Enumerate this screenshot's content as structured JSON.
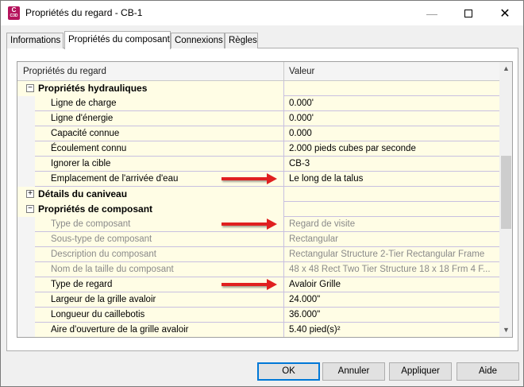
{
  "window": {
    "title": "Propriétés du regard - CB-1",
    "app_icon_letter": "C",
    "app_icon_sub": "C3D",
    "minimize_glyph": "—",
    "close_glyph": "✕"
  },
  "tabs": [
    {
      "label": "Informations",
      "active": false
    },
    {
      "label": "Propriétés du composant",
      "active": true
    },
    {
      "label": "Connexions",
      "active": false
    },
    {
      "label": "Règles",
      "active": false
    }
  ],
  "grid": {
    "headers": {
      "name": "Propriétés du regard",
      "value": "Valeur"
    },
    "rows": [
      {
        "kind": "category",
        "name": "Propriétés hydrauliques",
        "toggle": "−"
      },
      {
        "kind": "item",
        "name": "Ligne de charge",
        "value": "0.000'"
      },
      {
        "kind": "item",
        "name": "Ligne d'énergie",
        "value": "0.000'"
      },
      {
        "kind": "item",
        "name": "Capacité connue",
        "value": "0.000"
      },
      {
        "kind": "item",
        "name": "Écoulement connu",
        "value": "2.000 pieds cubes par seconde"
      },
      {
        "kind": "item",
        "name": "Ignorer la cible",
        "value": "CB-3"
      },
      {
        "kind": "item",
        "name": "Emplacement de l'arrivée d'eau",
        "value": "Le long de la talus"
      },
      {
        "kind": "category",
        "name": "Détails du caniveau",
        "toggle": "+"
      },
      {
        "kind": "category",
        "name": "Propriétés de composant",
        "toggle": "−"
      },
      {
        "kind": "dim",
        "name": "Type de composant",
        "value": "Regard de visite"
      },
      {
        "kind": "dim",
        "name": "Sous-type de composant",
        "value": "Rectangular"
      },
      {
        "kind": "dim",
        "name": "Description du composant",
        "value": "Rectangular Structure 2-Tier Rectangular Frame"
      },
      {
        "kind": "dim",
        "name": "Nom de la taille du composant",
        "value": "48 x 48 Rect Two Tier Structure 18 x 18 Frm 4 F..."
      },
      {
        "kind": "item",
        "name": "Type de regard",
        "value": "Avaloir Grille"
      },
      {
        "kind": "item",
        "name": "Largeur de la grille avaloir",
        "value": "24.000\""
      },
      {
        "kind": "item",
        "name": "Longueur du caillebotis",
        "value": "36.000\""
      },
      {
        "kind": "item",
        "name": "Aire d'ouverture de la grille avaloir",
        "value": "5.40 pied(s)²"
      }
    ]
  },
  "scrollbar": {
    "up_glyph": "▲",
    "down_glyph": "▼"
  },
  "buttons": {
    "ok": "OK",
    "cancel": "Annuler",
    "apply": "Appliquer",
    "help": "Aide"
  },
  "colors": {
    "annotation_arrow": "#e02020",
    "grid_background": "#fffde5",
    "default_button_border": "#0078d7"
  }
}
